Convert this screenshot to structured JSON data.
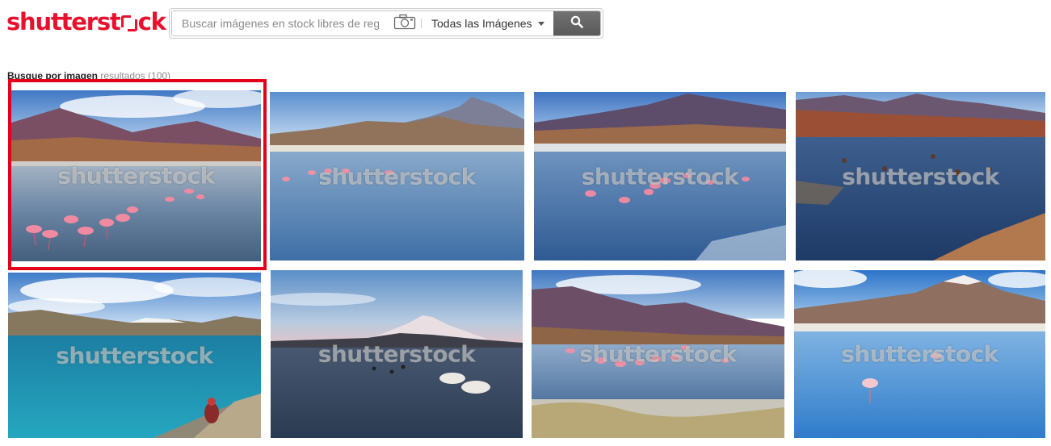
{
  "header": {
    "logo_text_main": "shutterst",
    "logo_text_tail": "ck",
    "logo_icon": "shutterstock-o-mark",
    "search_placeholder": "Buscar imágenes en stock libres de regalías",
    "camera_icon": "camera-icon",
    "type_select_value": "Todas las Imágenes",
    "search_button_icon": "search-icon"
  },
  "results": {
    "title": "Busque por imagen",
    "count_text": "resultados (100)"
  },
  "watermark": "shutterstock",
  "colors": {
    "brand_red": "#e8112d",
    "selection_red": "#e3001b"
  },
  "thumbnails": [
    {
      "scene": "flamingos-mountain-lagoon",
      "selected": true
    },
    {
      "scene": "flamingos-lagoon-volcano"
    },
    {
      "scene": "flamingos-blue-lagoon"
    },
    {
      "scene": "lagoon-red-shore"
    },
    {
      "scene": "turquoise-lake-person"
    },
    {
      "scene": "snowcapped-volcano-swans"
    },
    {
      "scene": "flamingos-reflective-lagoon"
    },
    {
      "scene": "flamingo-blue-lagoon-volcano"
    }
  ]
}
